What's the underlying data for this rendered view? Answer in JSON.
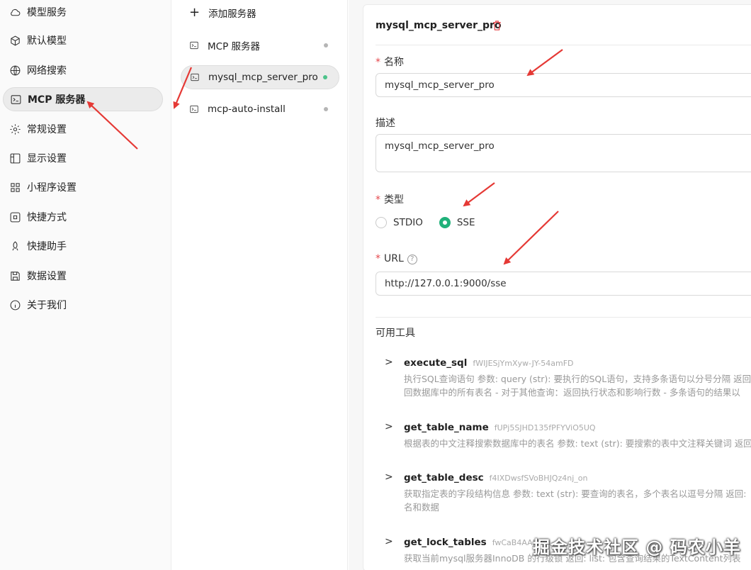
{
  "sidebar": {
    "items": [
      {
        "label": "模型服务",
        "icon": "cloud-icon"
      },
      {
        "label": "默认模型",
        "icon": "cube-icon"
      },
      {
        "label": "网络搜索",
        "icon": "globe-icon"
      },
      {
        "label": "MCP 服务器",
        "icon": "terminal-icon",
        "active": true
      },
      {
        "label": "常规设置",
        "icon": "gear-icon"
      },
      {
        "label": "显示设置",
        "icon": "layout-icon"
      },
      {
        "label": "小程序设置",
        "icon": "grid-icon"
      },
      {
        "label": "快捷方式",
        "icon": "command-icon"
      },
      {
        "label": "快捷助手",
        "icon": "rocket-icon"
      },
      {
        "label": "数据设置",
        "icon": "save-icon"
      },
      {
        "label": "关于我们",
        "icon": "info-icon"
      }
    ]
  },
  "servers": {
    "add_label": "添加服务器",
    "items": [
      {
        "label": "MCP 服务器",
        "status": "inactive"
      },
      {
        "label": "mysql_mcp_server_pro",
        "status": "active",
        "selected": true
      },
      {
        "label": "mcp-auto-install",
        "status": "inactive"
      }
    ]
  },
  "detail": {
    "title": "mysql_mcp_server_pro",
    "name_label": "名称",
    "name_value": "mysql_mcp_server_pro",
    "desc_label": "描述",
    "desc_value": "mysql_mcp_server_pro",
    "type_label": "类型",
    "type_options": [
      "STDIO",
      "SSE"
    ],
    "type_selected": "SSE",
    "url_label": "URL",
    "url_value": "http://127.0.0.1:9000/sse",
    "tools_label": "可用工具",
    "tools": [
      {
        "name": "execute_sql",
        "id": "fWIJESjYmXyw-JY-54amFD",
        "desc1": "执行SQL查询语句 参数: query (str): 要执行的SQL语句，支持多条语句以分号分隔 返回:",
        "desc2": "回数据库中的所有表名 - 对于其他查询：返回执行状态和影响行数 - 多条语句的结果以"
      },
      {
        "name": "get_table_name",
        "id": "fUPj5SJHD135fPFYViO5UQ",
        "desc1": "根据表的中文注释搜索数据库中的表名 参数: text (str): 要搜索的表中文注释关键词 返回",
        "desc2": ""
      },
      {
        "name": "get_table_desc",
        "id": "f4IXDwsfSVoBHJQz4nj_on",
        "desc1": "获取指定表的字段结构信息 参数: text (str): 要查询的表名，多个表名以逗号分隔 返回:",
        "desc2": "名和数据"
      },
      {
        "name": "get_lock_tables",
        "id": "fwCaB4AAJE0A",
        "desc1": "获取当前mysql服务器InnoDB 的行级锁 返回: list: 包含查询结果的TextContent列表",
        "desc2": ""
      }
    ]
  },
  "watermark": "掘金技术社区 @ 码农小羊",
  "colors": {
    "accent_green": "#20b17a",
    "required_red": "#e5484d",
    "arrow_red": "#e53935"
  }
}
